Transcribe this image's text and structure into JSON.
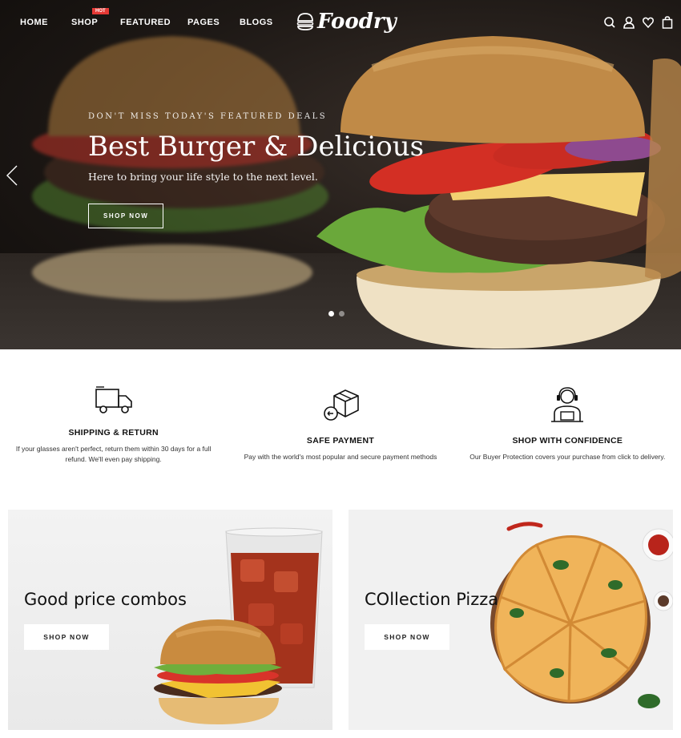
{
  "nav": {
    "items": [
      "HOME",
      "SHOP",
      "FEATURED",
      "PAGES",
      "BLOGS"
    ],
    "hot_badge": "HOT",
    "logo": "Foodry",
    "icons": [
      "search-icon",
      "user-icon",
      "heart-icon",
      "cart-icon"
    ]
  },
  "hero": {
    "kicker": "DON'T MISS TODAY'S FEATURED DEALS",
    "headline": "Best Burger & Delicious",
    "subtitle": "Here to bring your life style to the next level.",
    "button": "SHOP NOW",
    "slides": 2,
    "active_slide": 1
  },
  "features": [
    {
      "icon": "truck-icon",
      "title": "SHIPPING & RETURN",
      "desc": "If your glasses aren't perfect, return them within 30 days for a full refund. We'll even pay shipping."
    },
    {
      "icon": "box-return-icon",
      "title": "SAFE PAYMENT",
      "desc": "Pay with the world's most popular and secure payment methods"
    },
    {
      "icon": "support-agent-icon",
      "title": "SHOP WITH CONFIDENCE",
      "desc": "Our Buyer Protection covers your purchase from click to delivery."
    }
  ],
  "promos": [
    {
      "title": "Good price combos",
      "button": "SHOP NOW"
    },
    {
      "title": "COllection Pizza",
      "button": "SHOP NOW"
    }
  ],
  "colors": {
    "accent": "#e53935",
    "hero_bg": "#1d1815",
    "promo_bg": "#efefef"
  }
}
